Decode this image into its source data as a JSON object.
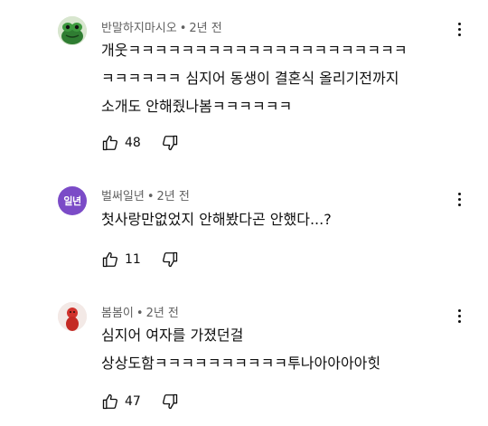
{
  "comments": [
    {
      "author": "반말하지마시오",
      "time": "2년 전",
      "text": "개웃ㅋㅋㅋㅋㅋㅋㅋㅋㅋㅋㅋㅋㅋㅋㅋㅋㅋㅋㅋㅋㅋ\nㅋㅋㅋㅋㅋㅋ 심지어 동생이 결혼식 올리기전까지\n소개도 안해줬나봄ㅋㅋㅋㅋㅋㅋ",
      "likes": "48",
      "avatar_icon": "frog-avatar-icon"
    },
    {
      "author": "벌써일년",
      "time": "2년 전",
      "text": "첫사랑만없었지 안해봤다곤 안했다...?",
      "likes": "11",
      "avatar_label": "일년",
      "avatar_color": "#7b4bc7"
    },
    {
      "author": "봄봄이",
      "time": "2년 전",
      "text": "심지어 여자를 가졌던걸\n상상도함ㅋㅋㅋㅋㅋㅋㅋㅋㅋㅋ투나아아아아힛",
      "likes": "47",
      "avatar_icon": "red-figure-avatar-icon"
    }
  ],
  "icons": {
    "like": "thumbs-up-icon",
    "dislike": "thumbs-down-icon",
    "menu": "more-vert-icon"
  },
  "colors": {
    "meta_text": "#606060",
    "body_text": "#0f0f0f"
  }
}
